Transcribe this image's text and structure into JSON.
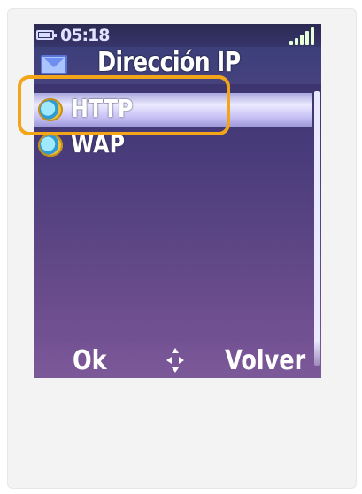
{
  "status_bar": {
    "time": "05:18",
    "battery_icon": "battery-icon",
    "signal_icon": "signal-strength-icon"
  },
  "header": {
    "title": "Dirección IP",
    "icon": "envelope-icon"
  },
  "list": {
    "items": [
      {
        "label": "HTTP",
        "icon": "globe-icon",
        "selected": true
      },
      {
        "label": "WAP",
        "icon": "globe-icon",
        "selected": false
      }
    ]
  },
  "softkeys": {
    "left": "Ok",
    "center_icon": "navigation-arrows-icon",
    "right": "Volver"
  },
  "colors": {
    "highlight_outline": "#f3a51a",
    "screen_top": "#352c62",
    "screen_bottom": "#7a5698",
    "selection": "#eceafe"
  }
}
